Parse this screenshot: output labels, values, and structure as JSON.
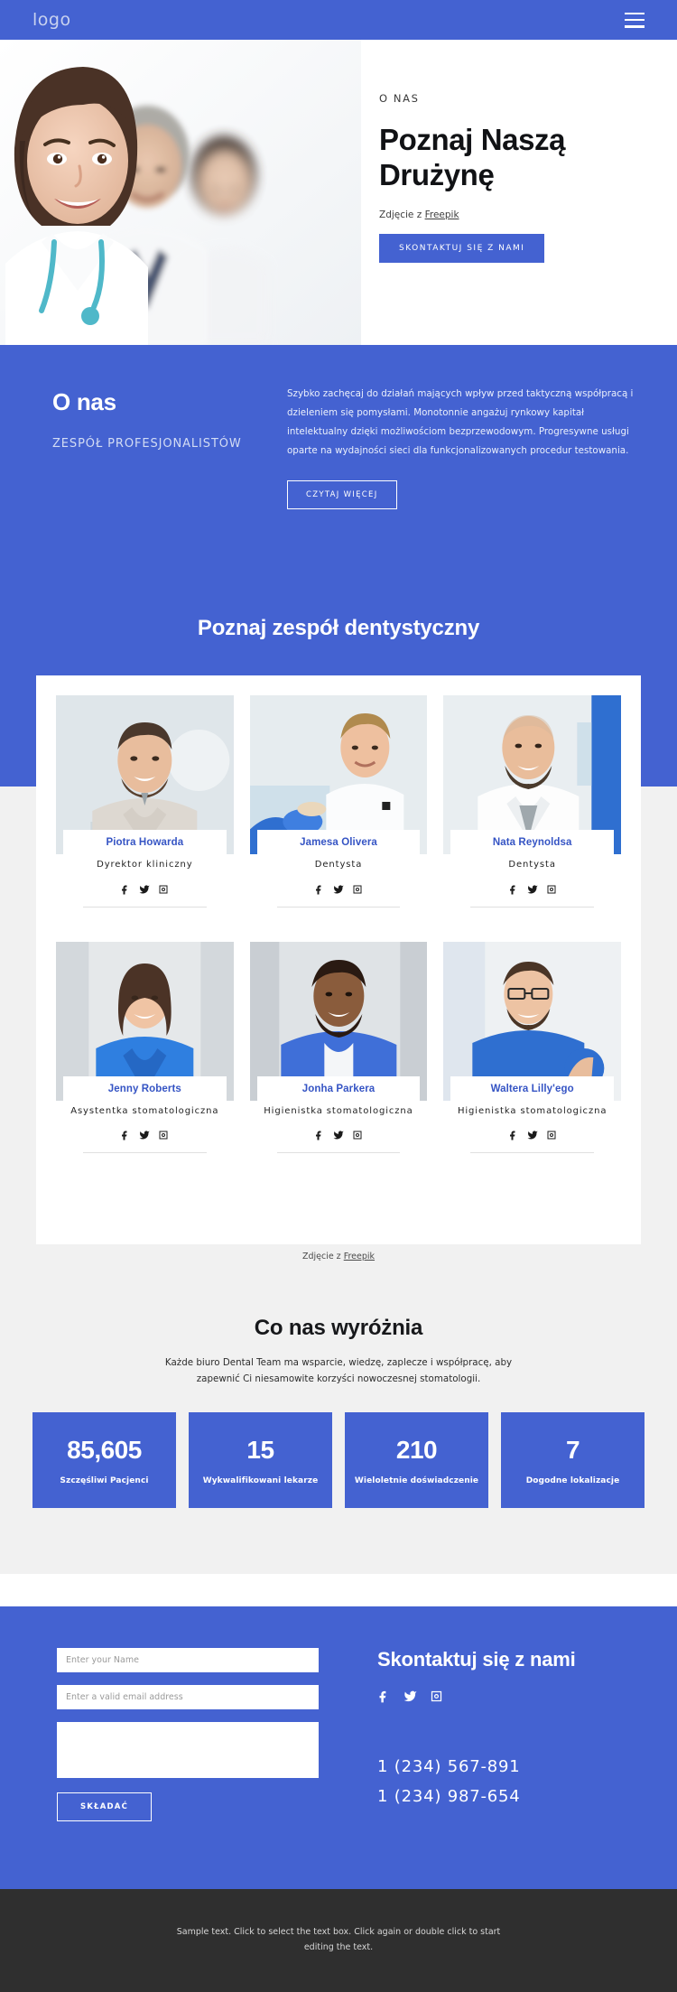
{
  "header": {
    "logo": "logo",
    "menu_icon": "hamburger-icon"
  },
  "hero": {
    "eyebrow": "O NAS",
    "title": "Poznaj Naszą Drużynę",
    "credit_prefix": "Zdjęcie z ",
    "credit_link": "Freepik",
    "cta": "SKONTAKTUJ SIĘ Z NAMI"
  },
  "about": {
    "heading": "O nas",
    "subheading": "ZESPÓŁ PROFESJONALISTÓW",
    "paragraph": "Szybko zachęcaj do działań mających wpływ przed taktyczną współpracą i dzieleniem się pomysłami. Monotonnie angażuj rynkowy kapitał intelektualny dzięki możliwościom bezprzewodowym. Progresywne usługi oparte na wydajności sieci dla funkcjonalizowanych procedur testowania.",
    "cta": "CZYTAJ WIĘCEJ"
  },
  "team": {
    "title": "Poznaj zespół dentystyczny",
    "credit_prefix": "Zdjęcie z ",
    "credit_link": "Freepik",
    "members": [
      {
        "name": "Piotra Howarda",
        "role": "Dyrektor kliniczny"
      },
      {
        "name": "Jamesa Olivera",
        "role": "Dentysta"
      },
      {
        "name": "Nata Reynoldsa",
        "role": "Dentysta"
      },
      {
        "name": "Jenny Roberts",
        "role": "Asystentka stomatologiczna"
      },
      {
        "name": "Jonha Parkera",
        "role": "Higienistka stomatologiczna"
      },
      {
        "name": "Waltera Lilly'ego",
        "role": "Higienistka stomatologiczna"
      }
    ],
    "social": [
      "facebook-icon",
      "twitter-icon",
      "instagram-icon"
    ]
  },
  "features": {
    "title": "Co nas wyróżnia",
    "subtitle": "Każde biuro Dental Team ma wsparcie, wiedzę, zaplecze i współpracę, aby zapewnić Ci niesamowite korzyści nowoczesnej stomatologii.",
    "stats": [
      {
        "value": "85,605",
        "label": "Szczęśliwi Pacjenci"
      },
      {
        "value": "15",
        "label": "Wykwalifikowani lekarze"
      },
      {
        "value": "210",
        "label": "Wieloletnie doświadczenie"
      },
      {
        "value": "7",
        "label": "Dogodne lokalizacje"
      }
    ]
  },
  "contact": {
    "heading": "Skontaktuj się z nami",
    "name_placeholder": "Enter your Name",
    "email_placeholder": "Enter a valid email address",
    "message_placeholder": "",
    "submit": "SKŁADAĆ",
    "phones": [
      "1 (234) 567-891",
      "1 (234) 987-654"
    ],
    "social": [
      "facebook-icon",
      "twitter-icon",
      "instagram-icon"
    ]
  },
  "footer": {
    "text": "Sample text. Click to select the text box. Click again or double click to start editing the text."
  },
  "colors": {
    "brand_blue": "#4462d1",
    "name_blue": "#3554c4",
    "grey_bg": "#f1f1f1",
    "footer_bg": "#2f2f2f"
  }
}
